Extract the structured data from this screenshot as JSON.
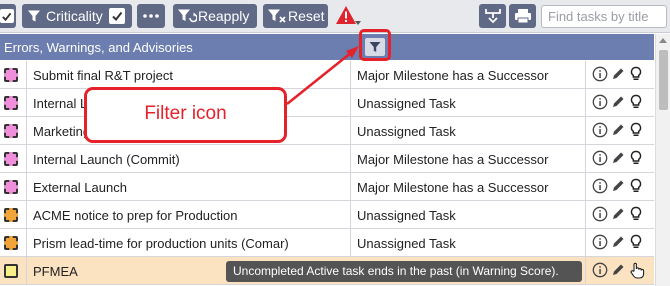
{
  "toolbar": {
    "criticality_label": "Criticality",
    "reapply_label": "Reapply",
    "reset_label": "Reset",
    "search_placeholder": "Find tasks by title"
  },
  "section": {
    "title": "Errors, Warnings, and Advisories"
  },
  "rows": [
    {
      "name": "Submit final R&T project",
      "issue": "Major Milestone has a Successor",
      "color": "pink"
    },
    {
      "name": "Internal L",
      "issue": "Unassigned Task",
      "color": "pink"
    },
    {
      "name": "Marketing",
      "issue": "Unassigned Task",
      "color": "pink"
    },
    {
      "name": "Internal Launch (Commit)",
      "issue": "Major Milestone has a Successor",
      "color": "pink"
    },
    {
      "name": "External Launch",
      "issue": "Major Milestone has a Successor",
      "color": "pink"
    },
    {
      "name": "ACME notice to prep for Production",
      "issue": "Unassigned Task",
      "color": "orange"
    },
    {
      "name": "Prism lead-time for production units (Comar)",
      "issue": "Unassigned Task",
      "color": "orange"
    },
    {
      "name": "PFMEA",
      "issue": "",
      "color": "yellow"
    }
  ],
  "callout": {
    "text": "Filter icon"
  },
  "tooltip": {
    "text": "Uncompleted Active task ends in the past (in Warning Score)."
  },
  "colors": {
    "toolbar_button": "#606a87",
    "section_header": "#6c7db0",
    "highlight_red": "#e5212a",
    "selected_row": "#fbe2c1",
    "pink": "#f08fd9",
    "orange": "#f0a43a",
    "yellow": "#f7f089"
  }
}
